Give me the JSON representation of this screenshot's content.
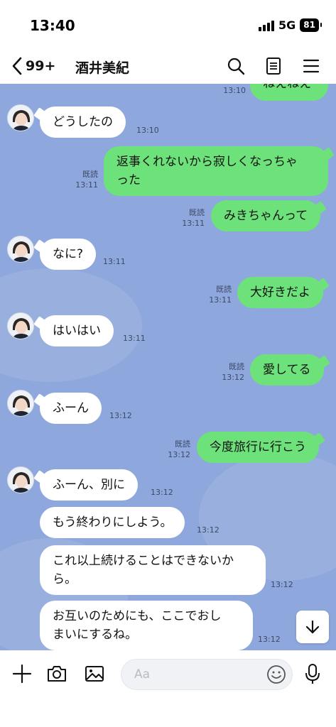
{
  "status": {
    "time": "13:40",
    "network": "5G",
    "battery": "81"
  },
  "header": {
    "back_count": "99+",
    "title": "酒井美紀"
  },
  "messages": {
    "m0": {
      "text": "ねえねえ",
      "time": "13:10"
    },
    "m1": {
      "text": "どうしたの",
      "time": "13:10"
    },
    "m2": {
      "line1": "返事くれないから寂しくなっちゃ",
      "line2": "った",
      "read": "既読",
      "time": "13:11"
    },
    "m3": {
      "text": "みきちゃんって",
      "read": "既読",
      "time": "13:11"
    },
    "m4": {
      "text": "なに?",
      "time": "13:11"
    },
    "m5": {
      "text": "大好きだよ",
      "read": "既読",
      "time": "13:11"
    },
    "m6": {
      "text": "はいはい",
      "time": "13:11"
    },
    "m7": {
      "text": "愛してる",
      "read": "既読",
      "time": "13:12"
    },
    "m8": {
      "text": "ふーん",
      "time": "13:12"
    },
    "m9": {
      "text": "今度旅行に行こう",
      "read": "既読",
      "time": "13:12"
    },
    "m10": {
      "text": "ふーん、別に",
      "time": "13:12"
    },
    "m11": {
      "text": "もう終わりにしよう。",
      "time": "13:12"
    },
    "m12": {
      "line1": "これ以上続けることはできないか",
      "line2": "ら。",
      "time": "13:12"
    },
    "m13": {
      "line1": "お互いのためにも、ここでおし",
      "line2": "まいにするね。",
      "time": "13:12"
    }
  },
  "input": {
    "placeholder": "Aa"
  },
  "colors": {
    "chat_bg": "#8ea7dc",
    "outgoing_bubble": "#6de27a",
    "incoming_bubble": "#ffffff"
  },
  "icons": {
    "back": "chevron-left-icon",
    "search": "search-icon",
    "notes": "notes-icon",
    "menu": "menu-icon",
    "add": "plus-icon",
    "camera": "camera-icon",
    "image": "image-icon",
    "emoji": "emoji-icon",
    "mic": "mic-icon",
    "scroll": "arrow-down-icon"
  }
}
